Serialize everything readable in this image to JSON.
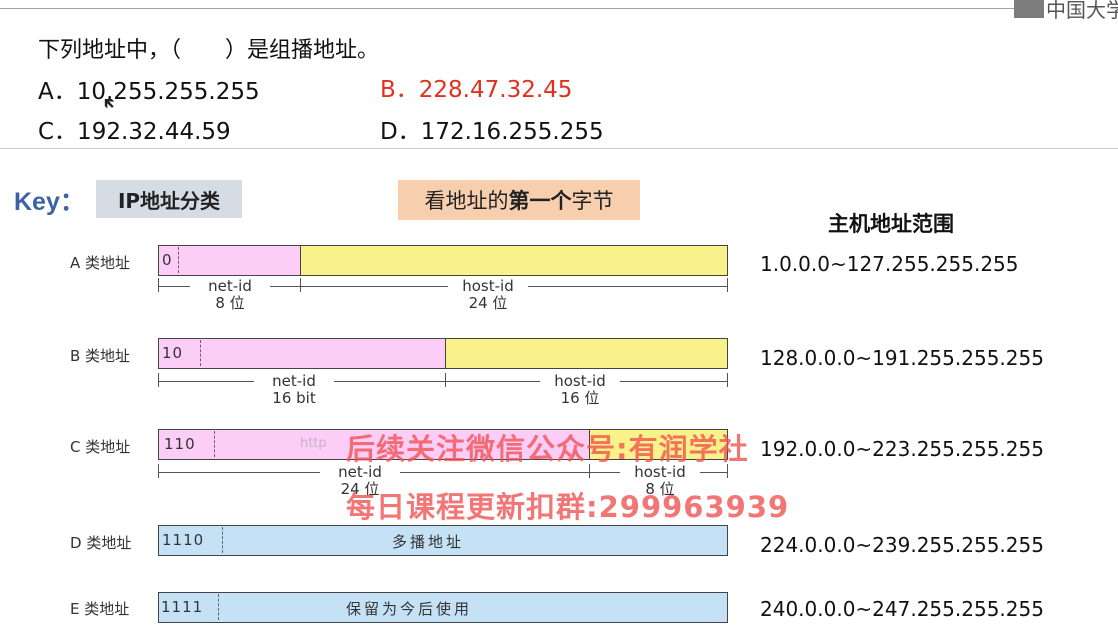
{
  "header": {
    "logo_text": "中国大学"
  },
  "question": {
    "text": "下列地址中，（　　）是组播地址。",
    "options": [
      {
        "label": "A．10.255.255.255"
      },
      {
        "label": "B．228.47.32.45",
        "highlight_color": "#e0301e"
      },
      {
        "label": "C．192.32.44.59"
      },
      {
        "label": "D．172.16.255.255"
      }
    ]
  },
  "key": {
    "label": "Key：",
    "ip_class_badge": "IP地址分类",
    "hint_prefix": "看地址的",
    "hint_bold": "第一个",
    "hint_suffix": "字节"
  },
  "range_title": "主机地址范围",
  "classes": [
    {
      "label": "A 类地址",
      "bits": "0",
      "net": "net-id",
      "net_size": "8 位",
      "host": "host-id",
      "host_size": "24 位",
      "range": "1.0.0.0~127.255.255.255"
    },
    {
      "label": "B 类地址",
      "bits": "10",
      "net": "net-id",
      "net_size": "16 bit",
      "host": "host-id",
      "host_size": "16 位",
      "range": "128.0.0.0~191.255.255.255"
    },
    {
      "label": "C 类地址",
      "bits": "110",
      "net": "net-id",
      "net_size": "24 位",
      "host": "host-id",
      "host_size": "8 位",
      "range": "192.0.0.0~223.255.255.255"
    },
    {
      "label": "D 类地址",
      "bits": "1110",
      "body": "多播地址",
      "range": "224.0.0.0~239.255.255.255"
    },
    {
      "label": "E 类地址",
      "bits": "1111",
      "body": "保留为今后使用",
      "range": "240.0.0.0~247.255.255.255"
    }
  ],
  "watermark": {
    "line1": "后续关注微信公众号:有润学社",
    "line2": "每日课程更新扣群:299963939",
    "faint": "http"
  },
  "colors": {
    "net_fill": "#fccdf7",
    "host_fill": "#f9f28a",
    "special_fill": "#c5e1f6",
    "answer": "#e0301e",
    "key": "#3b62a3"
  }
}
